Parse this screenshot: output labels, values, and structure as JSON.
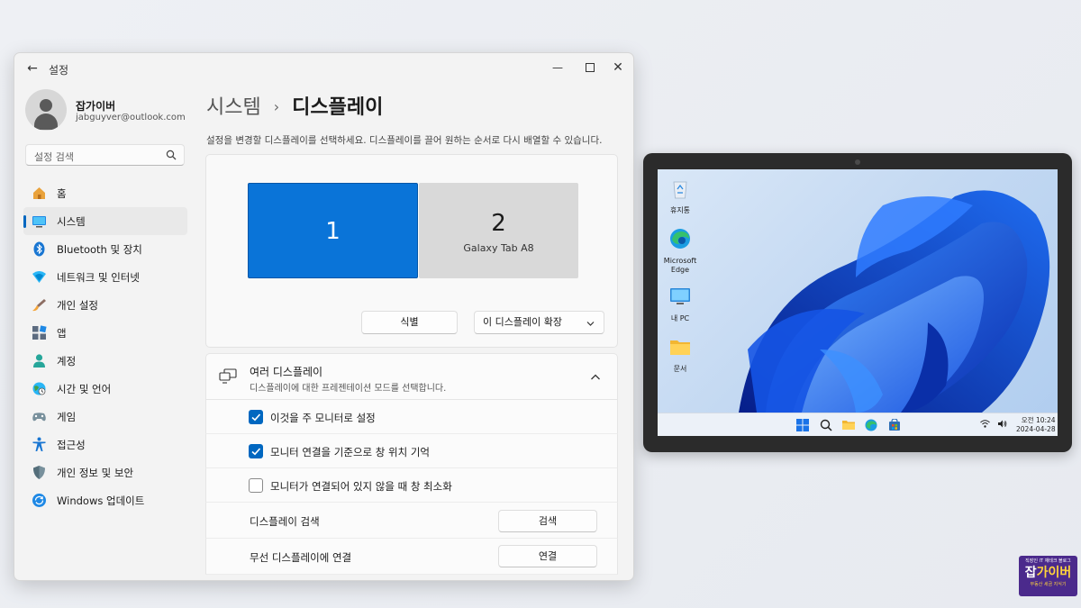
{
  "window": {
    "title": "설정",
    "back_icon": "back-arrow-icon",
    "controls": [
      "minimize-icon",
      "maximize-icon",
      "close-icon"
    ]
  },
  "profile": {
    "name": "잡가이버",
    "email": "jabguyver@outlook.com"
  },
  "search": {
    "placeholder": "설정 검색"
  },
  "sidebar": {
    "items": [
      {
        "label": "홈",
        "icon": "home-icon"
      },
      {
        "label": "시스템",
        "icon": "system-icon",
        "active": true
      },
      {
        "label": "Bluetooth 및 장치",
        "icon": "bluetooth-icon"
      },
      {
        "label": "네트워크 및 인터넷",
        "icon": "network-icon"
      },
      {
        "label": "개인 설정",
        "icon": "brush-icon"
      },
      {
        "label": "앱",
        "icon": "apps-icon"
      },
      {
        "label": "계정",
        "icon": "account-icon"
      },
      {
        "label": "시간 및 언어",
        "icon": "globe-clock-icon"
      },
      {
        "label": "게임",
        "icon": "gamepad-icon"
      },
      {
        "label": "접근성",
        "icon": "accessibility-icon"
      },
      {
        "label": "개인 정보 및 보안",
        "icon": "shield-icon"
      },
      {
        "label": "Windows 업데이트",
        "icon": "update-icon"
      }
    ]
  },
  "main": {
    "breadcrumb_parent": "시스템",
    "breadcrumb_separator": "›",
    "breadcrumb_current": "디스플레이",
    "description": "설정을 변경할 디스플레이를 선택하세요. 디스플레이를 끌어 원하는 순서로 다시 배열할 수 있습니다.",
    "monitors": [
      {
        "number": "1",
        "name": "",
        "selected": true
      },
      {
        "number": "2",
        "name": "Galaxy Tab A8",
        "selected": false
      }
    ],
    "identify_button": "식별",
    "extend_select": "이 디스플레이 확장",
    "multi_display": {
      "title": "여러 디스플레이",
      "subtitle": "디스플레이에 대한 프레젠테이션 모드를 선택합니다.",
      "options": [
        {
          "label": "이것을 주 모니터로 설정",
          "checked": true
        },
        {
          "label": "모니터 연결을 기준으로 창 위치 기억",
          "checked": true
        },
        {
          "label": "모니터가 연결되어 있지 않을 때 창 최소화",
          "checked": false
        }
      ],
      "detect_label": "디스플레이 검색",
      "detect_button": "검색",
      "wireless_label": "무선 디스플레이에 연결",
      "wireless_button": "연결"
    }
  },
  "tablet": {
    "desktop_icons": [
      {
        "label": "휴지통",
        "icon": "recycle-bin-icon"
      },
      {
        "label": "Microsoft Edge",
        "icon": "edge-icon"
      },
      {
        "label": "내 PC",
        "icon": "this-pc-icon"
      },
      {
        "label": "문서",
        "icon": "folder-icon"
      }
    ],
    "clock_time": "오전 10:24",
    "clock_date": "2024-04-28"
  },
  "watermark": {
    "top": "직장인 IT 재테크 블로그",
    "main_a": "잡",
    "main_b": "가이버",
    "bottom": "부동산 세금 지식기"
  },
  "colors": {
    "accent": "#0067c0",
    "monitor_selected": "#0a74d8",
    "watermark_bg": "#4b2a8c"
  }
}
